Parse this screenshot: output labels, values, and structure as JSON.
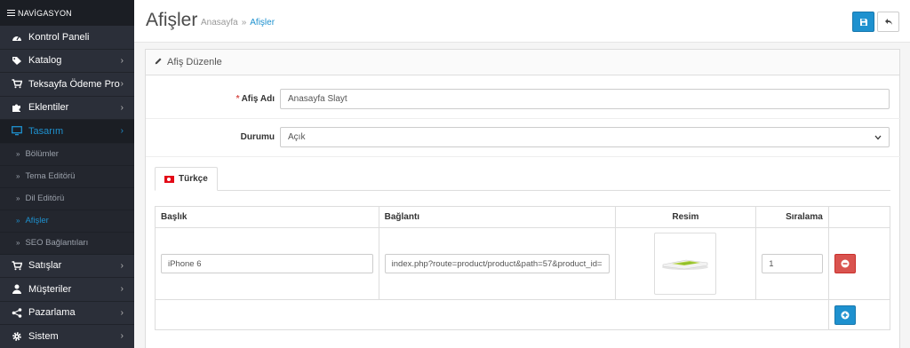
{
  "sidebar": {
    "header": "NAVİGASYON",
    "items": [
      {
        "label": "Kontrol Paneli",
        "icon": "dashboard-icon",
        "chevron": false,
        "active": false
      },
      {
        "label": "Katalog",
        "icon": "tags-icon",
        "chevron": true,
        "active": false
      },
      {
        "label": "Teksayfa Ödeme Pro",
        "icon": "cart-icon",
        "chevron": true,
        "active": false
      },
      {
        "label": "Eklentiler",
        "icon": "puzzle-icon",
        "chevron": true,
        "active": false
      },
      {
        "label": "Tasarım",
        "icon": "desktop-icon",
        "chevron": true,
        "active": true
      }
    ],
    "subitems": [
      {
        "label": "Bölümler",
        "active": false
      },
      {
        "label": "Tema Editörü",
        "active": false
      },
      {
        "label": "Dil Editörü",
        "active": false
      },
      {
        "label": "Afişler",
        "active": true
      },
      {
        "label": "SEO Bağlantıları",
        "active": false
      }
    ],
    "items_after": [
      {
        "label": "Satışlar",
        "icon": "cart-icon",
        "chevron": true
      },
      {
        "label": "Müşteriler",
        "icon": "user-icon",
        "chevron": true
      },
      {
        "label": "Pazarlama",
        "icon": "share-icon",
        "chevron": true
      },
      {
        "label": "Sistem",
        "icon": "cog-icon",
        "chevron": true
      }
    ]
  },
  "header": {
    "title": "Afişler",
    "breadcrumb_home": "Anasayfa",
    "breadcrumb_sep": "»",
    "breadcrumb_current": "Afişler"
  },
  "panel": {
    "title": "Afiş Düzenle"
  },
  "form": {
    "name_label": "Afiş Adı",
    "name_value": "Anasayfa Slayt",
    "status_label": "Durumu",
    "status_value": "Açık"
  },
  "tab": {
    "label": "Türkçe"
  },
  "table": {
    "headers": [
      "Başlık",
      "Bağlantı",
      "Resim",
      "Sıralama"
    ],
    "rows": [
      {
        "title": "iPhone 6",
        "link": "index.php?route=product/product&path=57&product_id=",
        "sort": "1"
      }
    ]
  },
  "colors": {
    "primary": "#1e91cf",
    "danger": "#d9534f",
    "sidebar_bg": "#2b2f39"
  }
}
